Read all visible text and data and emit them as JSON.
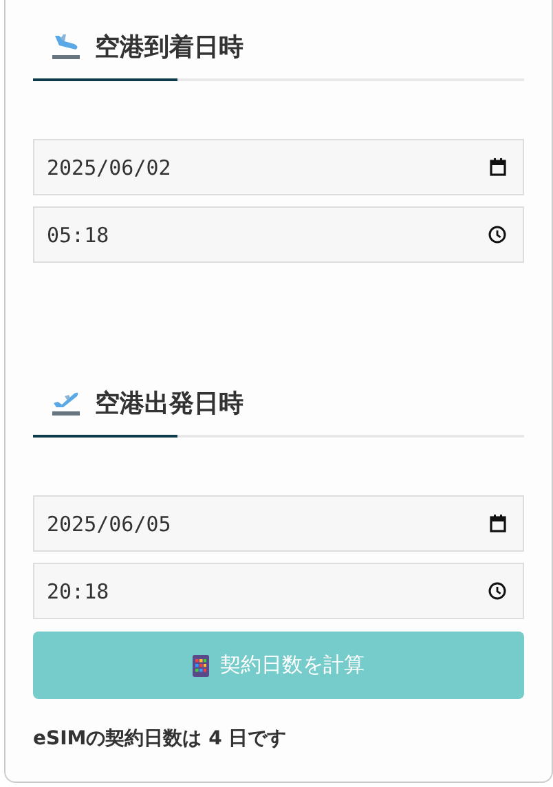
{
  "sections": [
    {
      "kind": "arrival",
      "title": "空港到着日時",
      "date": "2025/06/02",
      "time": "05:18"
    },
    {
      "kind": "departure",
      "title": "空港出発日時",
      "date": "2025/06/05",
      "time": "20:18"
    }
  ],
  "button": {
    "label": "契約日数を計算",
    "disabled": true
  },
  "result": {
    "prefix": "eSIMの契約日数は ",
    "days": "4",
    "suffix": " 日です"
  }
}
